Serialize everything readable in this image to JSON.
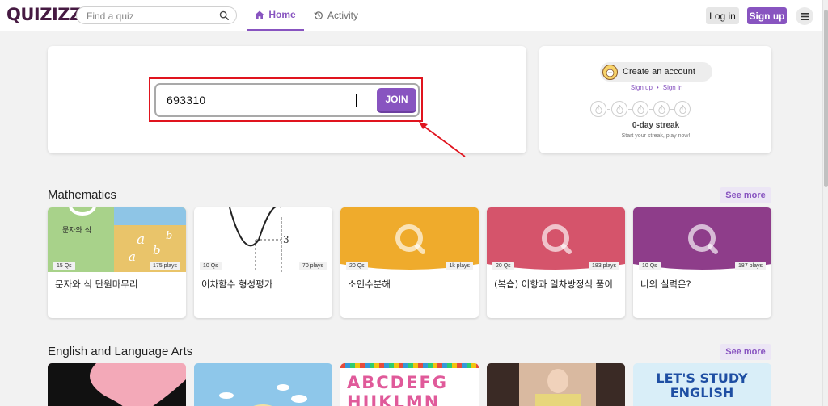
{
  "header": {
    "logo": "QUIZIZZ",
    "search_placeholder": "Find a quiz",
    "tabs": [
      {
        "label": "Home",
        "icon": "home-icon",
        "active": true
      },
      {
        "label": "Activity",
        "icon": "history-icon",
        "active": false
      }
    ],
    "login_label": "Log in",
    "signup_label": "Sign up"
  },
  "join": {
    "code_value": "693310",
    "button_label": "JOIN"
  },
  "account": {
    "create_label": "Create an account",
    "signup_link": "Sign up",
    "separator": "•",
    "signin_link": "Sign in",
    "streak_title": "0-day streak",
    "streak_subtitle": "Start your streak, play now!",
    "streak_days": 5
  },
  "sections": [
    {
      "title": "Mathematics",
      "see_more": "See more",
      "cards": [
        {
          "title": "문자와 식 단원마무리",
          "questions": "15 Qs",
          "plays": "175 plays",
          "thumb_text": "문자와 식"
        },
        {
          "title": "이차함수 형성평가",
          "questions": "10 Qs",
          "plays": "70 plays",
          "thumb_text": "3"
        },
        {
          "title": "소인수분해",
          "questions": "20 Qs",
          "plays": "1k plays"
        },
        {
          "title": "(복습) 이항과 일차방정식 풀이",
          "questions": "20 Qs",
          "plays": "183 plays"
        },
        {
          "title": "너의 실력은?",
          "questions": "10 Qs",
          "plays": "187 plays"
        }
      ]
    },
    {
      "title": "English and Language Arts",
      "see_more": "See more",
      "cards": [
        {
          "thumb_text": ""
        },
        {
          "thumb_text": ""
        },
        {
          "thumb_text": "ABCDEFG HIJKLMN"
        },
        {
          "thumb_text": ""
        },
        {
          "thumb_text": "LET'S STUDY ENGLISH"
        }
      ]
    }
  ],
  "colors": {
    "brand": "#8854c0",
    "logo": "#461a42",
    "highlight_box": "#e0141e",
    "card_yellow": "#efab2c",
    "card_pink": "#d5546b",
    "card_purple": "#8e3d8a"
  }
}
